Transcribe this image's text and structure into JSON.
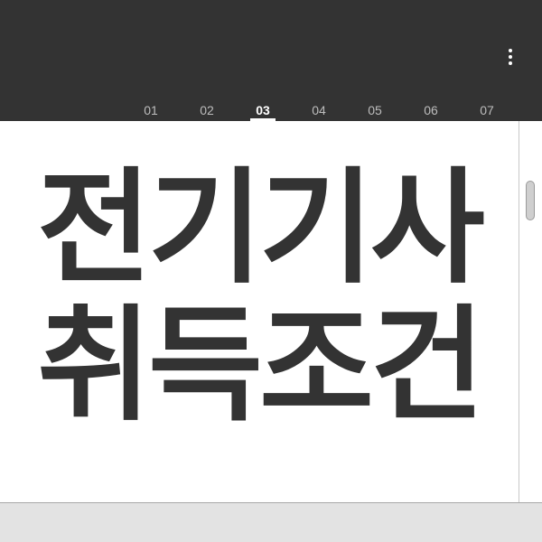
{
  "header": {
    "menu_icon": "more-vertical-icon",
    "tabs": [
      {
        "label": "01",
        "active": false
      },
      {
        "label": "02",
        "active": false
      },
      {
        "label": "03",
        "active": true
      },
      {
        "label": "04",
        "active": false
      },
      {
        "label": "05",
        "active": false
      },
      {
        "label": "06",
        "active": false
      },
      {
        "label": "07",
        "active": false
      }
    ]
  },
  "main": {
    "title_line_1": "전기기사",
    "title_line_2": "취득조건"
  },
  "colors": {
    "header_bg": "#333333",
    "title_text": "#333333",
    "tab_inactive": "#bdbdbd",
    "tab_active": "#ffffff"
  }
}
